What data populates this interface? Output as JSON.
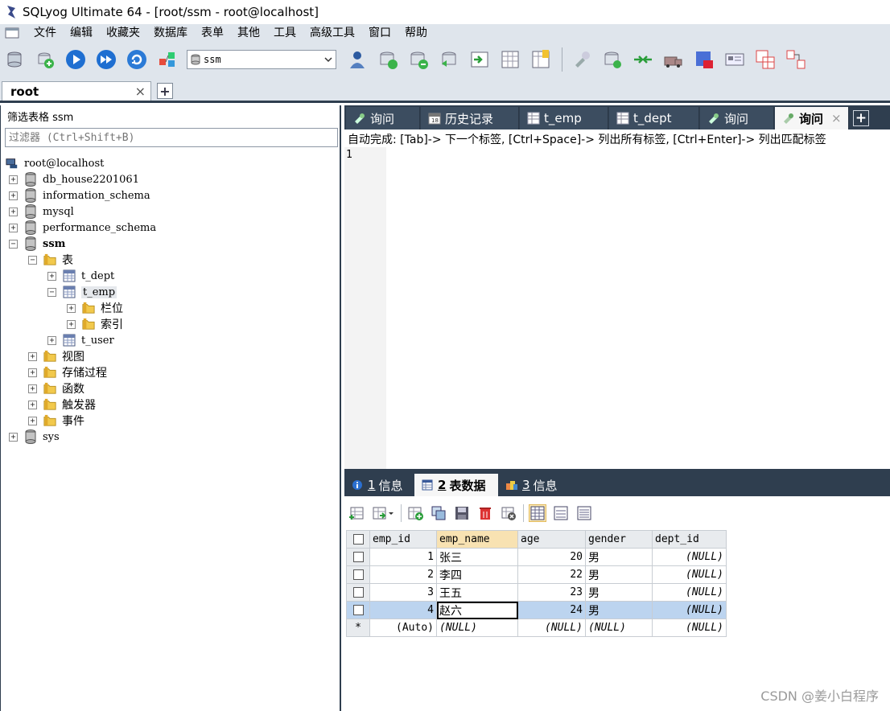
{
  "window": {
    "title": "SQLyog Ultimate 64 - [root/ssm - root@localhost]"
  },
  "menu": [
    "文件",
    "编辑",
    "收藏夹",
    "数据库",
    "表单",
    "其他",
    "工具",
    "高级工具",
    "窗口",
    "帮助"
  ],
  "toolbar": {
    "db_value": "ssm"
  },
  "connection_tab": {
    "label": "root",
    "close": "×",
    "add": "+"
  },
  "object_browser": {
    "filter_label": "筛选表格 ssm",
    "filter_placeholder": "过滤器 (Ctrl+Shift+B)",
    "root": "root@localhost",
    "databases": [
      "db_house2201061",
      "information_schema",
      "mysql",
      "performance_schema",
      "ssm",
      "sys"
    ],
    "ssm_children": {
      "tables_folder": "表",
      "tables": [
        "t_dept",
        "t_emp",
        "t_user"
      ],
      "t_emp_children": [
        "栏位",
        "索引"
      ],
      "folders": [
        "视图",
        "存储过程",
        "函数",
        "触发器",
        "事件"
      ]
    },
    "expanders": {
      "plus": "+",
      "minus": "−"
    }
  },
  "query_tabs": [
    {
      "label": "询问",
      "icon": "query-icon"
    },
    {
      "label": "历史记录",
      "icon": "history-icon"
    },
    {
      "label": "t_emp",
      "icon": "table-icon"
    },
    {
      "label": "t_dept",
      "icon": "table-icon"
    },
    {
      "label": "询问",
      "icon": "query-icon"
    },
    {
      "label": "询问",
      "icon": "query-icon",
      "active": true,
      "close": "×"
    }
  ],
  "query_add": "+",
  "editor": {
    "autocomplete_hint": "自动完成: [Tab]-> 下一个标签, [Ctrl+Space]-> 列出所有标签, [Ctrl+Enter]-> 列出匹配标签",
    "line_number": "1"
  },
  "result_tabs": [
    {
      "num": "1",
      "label": "信息",
      "icon": "info-icon"
    },
    {
      "num": "2",
      "label": "表数据",
      "icon": "table-data-icon",
      "active": true
    },
    {
      "num": "3",
      "label": "信息",
      "icon": "info2-icon"
    }
  ],
  "result_table": {
    "columns": [
      "emp_id",
      "emp_name",
      "age",
      "gender",
      "dept_id"
    ],
    "rows": [
      [
        "1",
        "张三",
        "20",
        "男",
        "(NULL)"
      ],
      [
        "2",
        "李四",
        "22",
        "男",
        "(NULL)"
      ],
      [
        "3",
        "王五",
        "23",
        "男",
        "(NULL)"
      ],
      [
        "4",
        "赵六",
        "24",
        "男",
        "(NULL)"
      ]
    ],
    "new_row": [
      "*",
      "(Auto)",
      "(NULL)",
      "(NULL)",
      "(NULL)",
      "(NULL)"
    ]
  },
  "watermark": "CSDN @姜小白程序",
  "colors": {
    "dark_panel": "#2f3e4f",
    "toolbar_bg": "#dfe5ec",
    "selected_row": "#bcd4ef"
  }
}
